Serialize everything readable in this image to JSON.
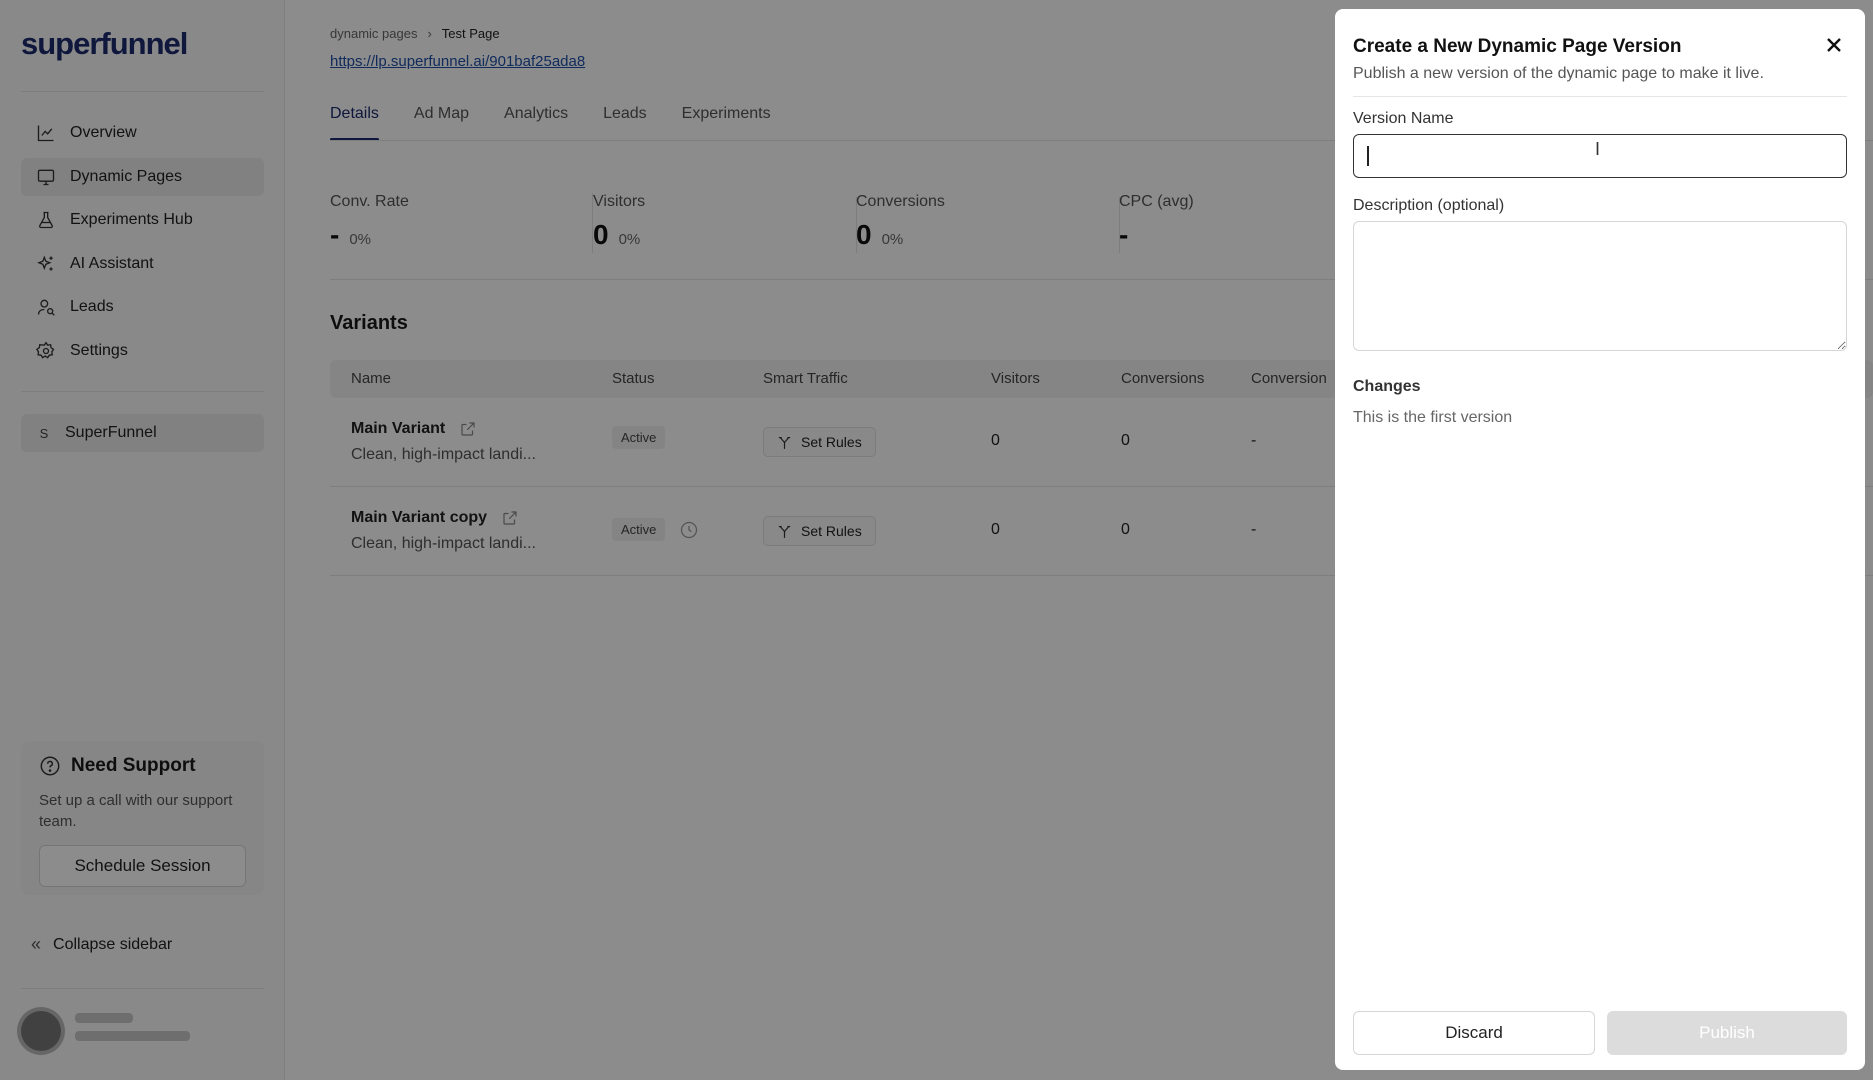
{
  "sidebar": {
    "logo": "superfunnel",
    "nav": [
      {
        "label": "Overview",
        "icon": "chart-line-icon"
      },
      {
        "label": "Dynamic Pages",
        "icon": "monitor-icon",
        "active": true
      },
      {
        "label": "Experiments Hub",
        "icon": "flask-icon"
      },
      {
        "label": "AI Assistant",
        "icon": "sparkles-icon"
      },
      {
        "label": "Leads",
        "icon": "user-search-icon"
      },
      {
        "label": "Settings",
        "icon": "gear-icon"
      }
    ],
    "workspace": {
      "badge": "S",
      "label": "SuperFunnel"
    },
    "support": {
      "title": "Need Support",
      "description": "Set up a call with our support team.",
      "button": "Schedule Session"
    },
    "collapse_label": "Collapse sidebar"
  },
  "header": {
    "breadcrumb": [
      "dynamic pages",
      "Test Page"
    ],
    "breadcrumb_sep": "›",
    "url": "https://lp.superfunnel.ai/901baf25ada8"
  },
  "tabs": [
    "Details",
    "Ad Map",
    "Analytics",
    "Leads",
    "Experiments"
  ],
  "active_tab": "Details",
  "stats": [
    {
      "label": "Conv. Rate",
      "value": "-",
      "pct": "0%"
    },
    {
      "label": "Visitors",
      "value": "0",
      "pct": "0%"
    },
    {
      "label": "Conversions",
      "value": "0",
      "pct": "0%"
    },
    {
      "label": "CPC (avg)",
      "value": "-",
      "pct": ""
    }
  ],
  "variants": {
    "title": "Variants",
    "columns": [
      "Name",
      "Status",
      "Smart Traffic",
      "Visitors",
      "Conversions",
      "Conversion"
    ],
    "rows": [
      {
        "name": "Main Variant",
        "desc": "Clean, high-impact landi...",
        "status": "Active",
        "rules": "Set Rules",
        "visitors": "0",
        "conversions": "0",
        "rate": "-",
        "scheduled": false
      },
      {
        "name": "Main Variant copy",
        "desc": "Clean, high-impact landi...",
        "status": "Active",
        "rules": "Set Rules",
        "visitors": "0",
        "conversions": "0",
        "rate": "-",
        "scheduled": true
      }
    ]
  },
  "drawer": {
    "title": "Create a New Dynamic Page Version",
    "subtitle": "Publish a new version of the dynamic page to make it live.",
    "version_label": "Version Name",
    "version_value": "",
    "description_label": "Description (optional)",
    "description_value": "",
    "changes_label": "Changes",
    "changes_text": "This is the first version",
    "discard": "Discard",
    "publish": "Publish"
  }
}
